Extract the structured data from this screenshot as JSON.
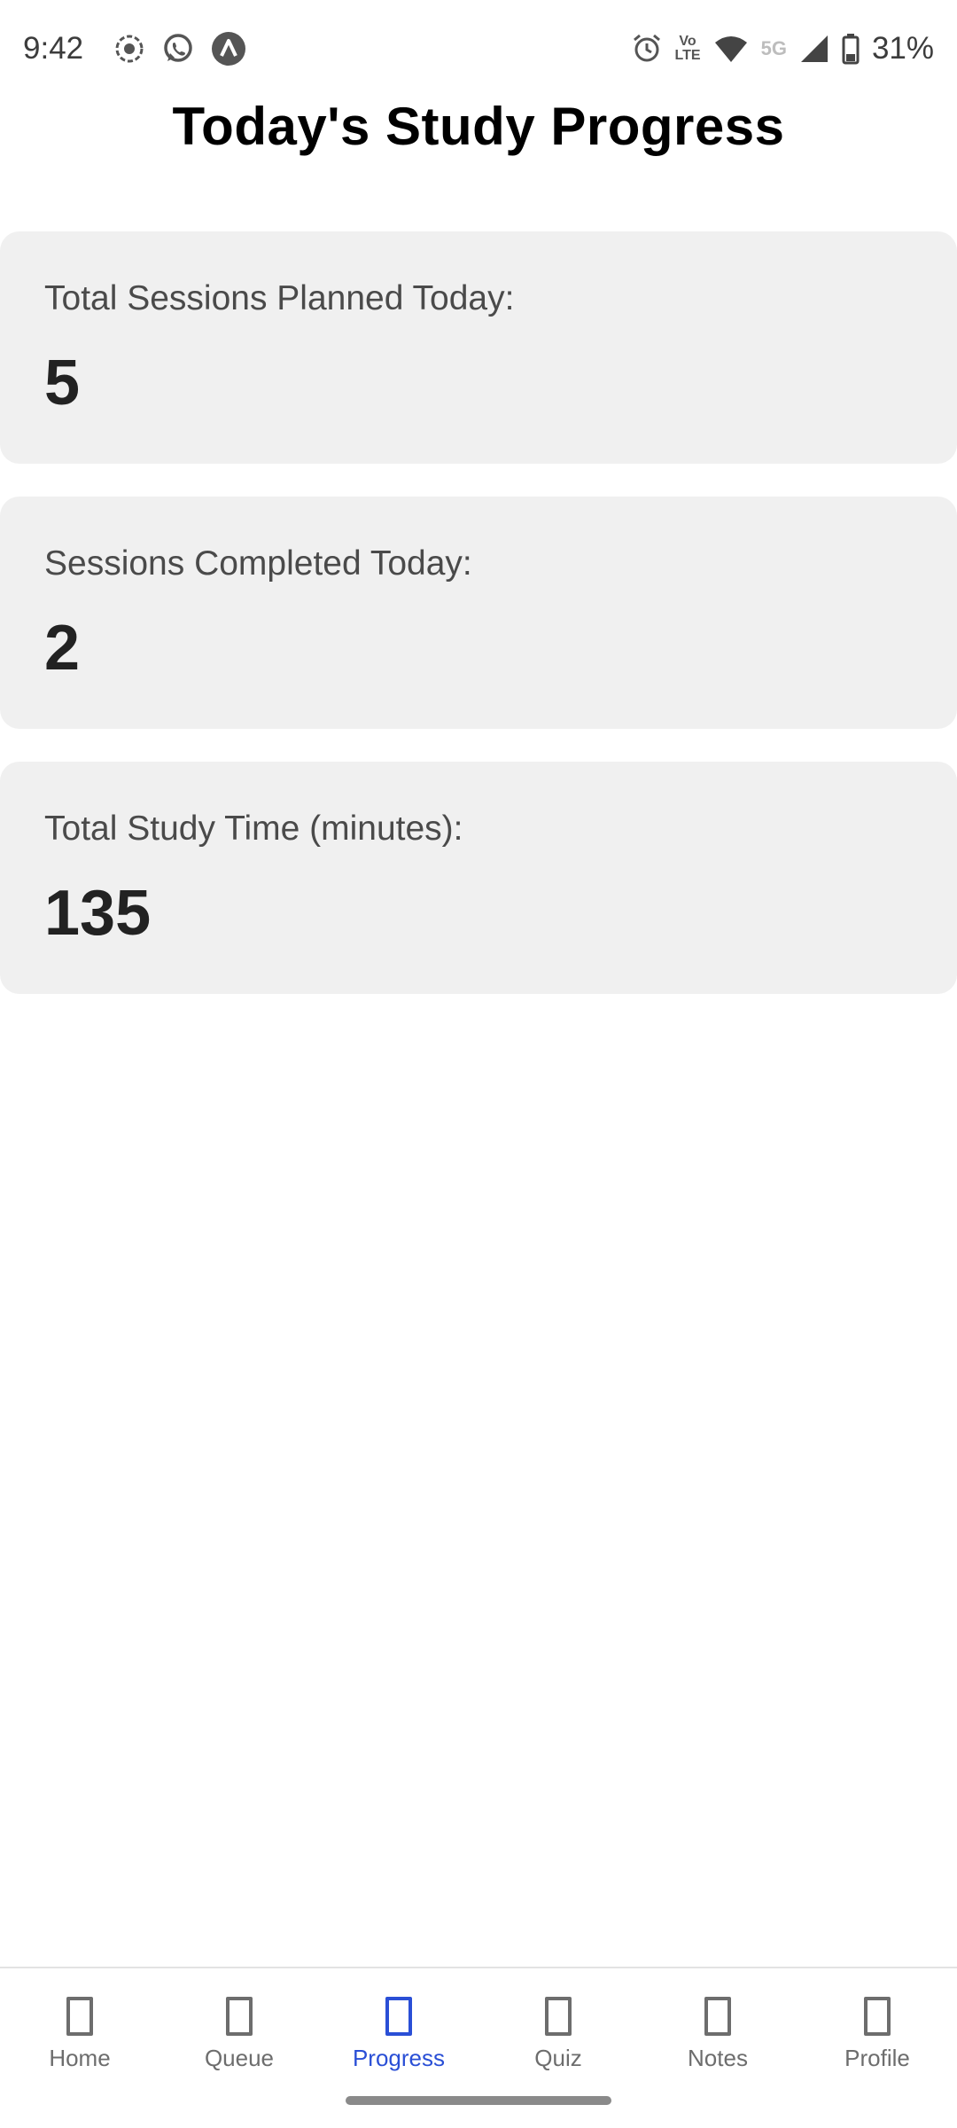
{
  "status_bar": {
    "time": "9:42",
    "battery_text": "31%",
    "left_icons": [
      "screen-record-icon",
      "whatsapp-icon",
      "app-notification-icon"
    ],
    "right_icons": [
      "alarm-icon",
      "volte-icon",
      "wifi-icon",
      "5g-icon",
      "cell-signal-icon",
      "battery-icon"
    ],
    "volte_line1": "Vo",
    "volte_line2": "LTE",
    "fiveg": "5G"
  },
  "page": {
    "title": "Today's Study Progress"
  },
  "cards": [
    {
      "label": "Total Sessions Planned Today:",
      "value": "5"
    },
    {
      "label": "Sessions Completed Today:",
      "value": "2"
    },
    {
      "label": "Total Study Time (minutes):",
      "value": "135"
    }
  ],
  "nav": {
    "items": [
      {
        "label": "Home"
      },
      {
        "label": "Queue"
      },
      {
        "label": "Progress"
      },
      {
        "label": "Quiz"
      },
      {
        "label": "Notes"
      },
      {
        "label": "Profile"
      }
    ],
    "active": "Progress"
  },
  "colors": {
    "accent": "#2a4fd6",
    "card_bg": "#f0f0f0",
    "inactive": "#6d6d6d"
  }
}
